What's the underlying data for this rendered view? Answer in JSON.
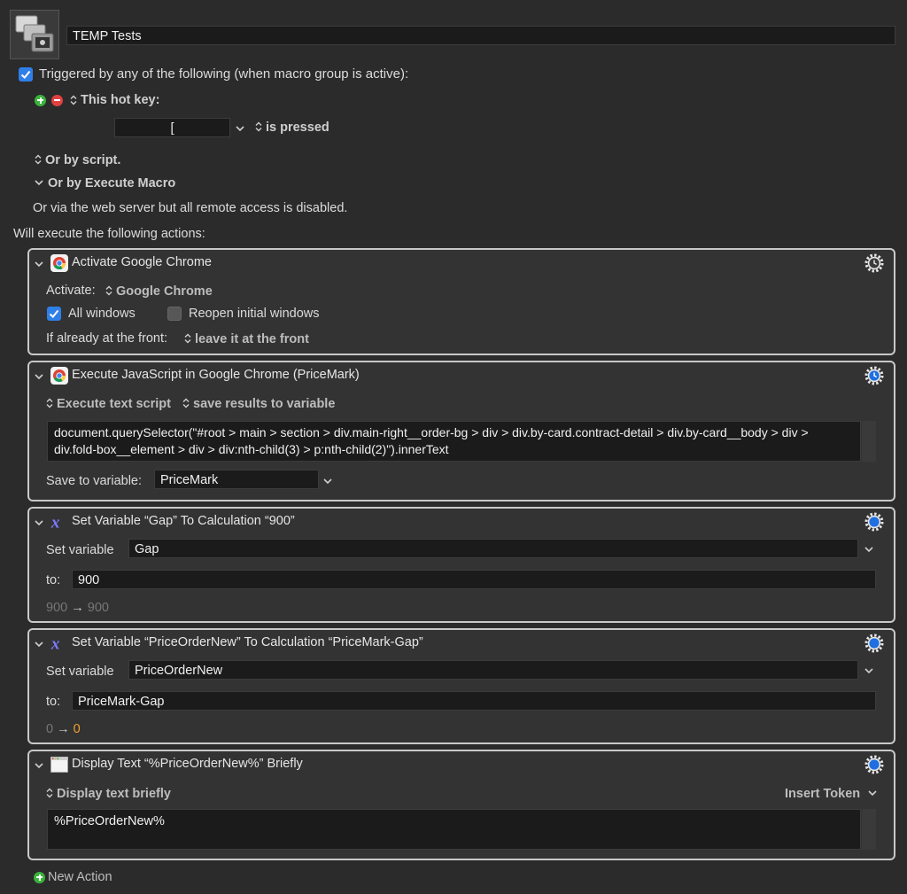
{
  "header": {
    "macro_name": "TEMP Tests",
    "icon": "macro-group-icon"
  },
  "triggers": {
    "triggered_label": "Triggered by any of the following (when macro group is active):",
    "hotkey_label": "This hot key:",
    "hotkey_value": "[",
    "is_pressed": "is pressed",
    "or_script": "Or by script.",
    "or_execute": "Or by Execute Macro",
    "web_server": "Or via the web server but all remote access is disabled."
  },
  "actions_label": "Will execute the following actions:",
  "actions": {
    "a1": {
      "title": "Activate Google Chrome",
      "activate_label": "Activate:",
      "activate_value": "Google Chrome",
      "all_windows": "All windows",
      "reopen": "Reopen initial windows",
      "front_label": "If already at the front:",
      "front_value": "leave it at the front"
    },
    "a2": {
      "title": "Execute JavaScript in Google Chrome (PriceMark)",
      "mode": "Execute text script",
      "result": "save results to variable",
      "script_line1": "document.querySelector(\"#root > main > section > div.main-right__order-bg > div > div.by-card.contract-detail > div.by-card__body > div >",
      "script_line2": "div.fold-box__element > div > div:nth-child(3) > p:nth-child(2)\").innerText",
      "save_label": "Save to variable:",
      "save_value": "PriceMark"
    },
    "a3": {
      "title": "Set Variable “Gap” To Calculation “900”",
      "set_label": "Set variable",
      "set_value": "Gap",
      "to_label": "to:",
      "to_value": "900",
      "preview_from": "900",
      "preview_to": "900"
    },
    "a4": {
      "title": "Set Variable “PriceOrderNew” To Calculation “PriceMark-Gap”",
      "set_label": "Set variable",
      "set_value": "PriceOrderNew",
      "to_label": "to:",
      "to_value": "PriceMark-Gap",
      "preview_from": "0",
      "preview_to": "0"
    },
    "a5": {
      "title": "Display Text “%PriceOrderNew%” Briefly",
      "mode": "Display text briefly",
      "insert_token": "Insert Token",
      "text": "%PriceOrderNew%"
    }
  },
  "footer": {
    "new_action": "New Action"
  },
  "colors": {
    "accent": "#2f7fe8",
    "panel_border": "#c8c8c8",
    "orange_value": "#f0a030",
    "gear_blue": "#1f6fe0"
  }
}
